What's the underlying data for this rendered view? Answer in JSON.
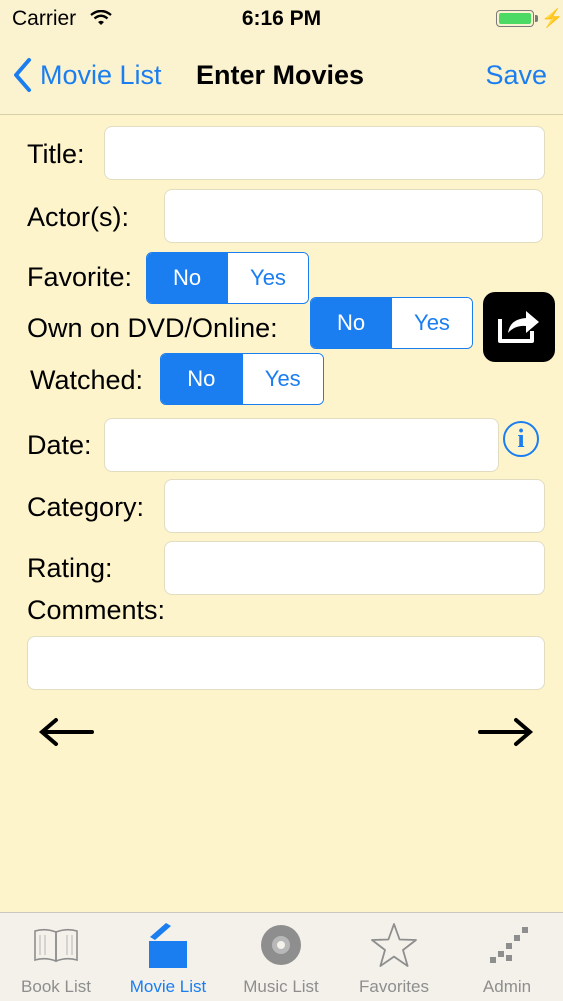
{
  "status": {
    "carrier": "Carrier",
    "time": "6:16 PM"
  },
  "nav": {
    "back_label": "Movie List",
    "title": "Enter Movies",
    "save_label": "Save"
  },
  "form": {
    "title_label": "Title:",
    "actors_label": "Actor(s):",
    "favorite_label": "Favorite:",
    "own_label": "Own on DVD/Online:",
    "watched_label": "Watched:",
    "date_label": "Date:",
    "category_label": "Category:",
    "rating_label": "Rating:",
    "comments_label": "Comments:",
    "title_value": "",
    "actors_value": "",
    "date_value": "",
    "category_value": "",
    "rating_value": "",
    "comments_value": "",
    "no_option": "No",
    "yes_option": "Yes",
    "favorite_selected": "No",
    "own_selected": "No",
    "watched_selected": "No",
    "info_glyph": "i"
  },
  "tabs": [
    {
      "label": "Book List",
      "icon": "book-icon",
      "active": false
    },
    {
      "label": "Movie List",
      "icon": "clapperboard-icon",
      "active": true
    },
    {
      "label": "Music List",
      "icon": "disc-icon",
      "active": false
    },
    {
      "label": "Favorites",
      "icon": "star-icon",
      "active": false
    },
    {
      "label": "Admin",
      "icon": "admin-icon",
      "active": false
    }
  ],
  "colors": {
    "accent": "#1a7ef0",
    "background": "#fdf4cc",
    "battery": "#4cd964"
  }
}
